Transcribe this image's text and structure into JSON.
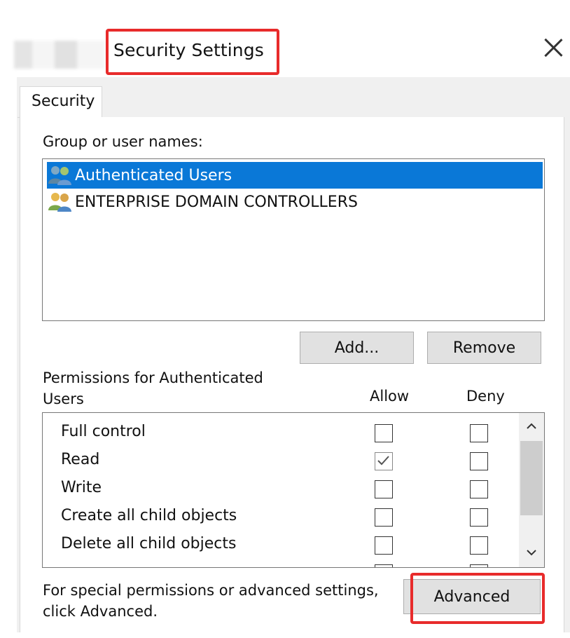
{
  "window": {
    "title": "Security Settings"
  },
  "tabs": [
    {
      "label": "Security"
    }
  ],
  "group_section": {
    "label": "Group or user names:",
    "users": [
      {
        "name": "Authenticated Users",
        "selected": true,
        "icon": "users-group-icon"
      },
      {
        "name": "ENTERPRISE DOMAIN CONTROLLERS",
        "selected": false,
        "icon": "users-group-icon"
      }
    ],
    "add_button": "Add...",
    "remove_button": "Remove"
  },
  "permissions": {
    "label_line1": "Permissions for Authenticated",
    "label_line2": "Users",
    "allow_header": "Allow",
    "deny_header": "Deny",
    "rows": [
      {
        "name": "Full control",
        "allow": false,
        "deny": false
      },
      {
        "name": "Read",
        "allow": true,
        "deny": false
      },
      {
        "name": "Write",
        "allow": false,
        "deny": false
      },
      {
        "name": "Create all child objects",
        "allow": false,
        "deny": false
      },
      {
        "name": "Delete all child objects",
        "allow": false,
        "deny": false
      }
    ]
  },
  "advanced": {
    "text_line1": "For special permissions or advanced settings,",
    "text_line2": "click Advanced.",
    "button": "Advanced"
  },
  "colors": {
    "selection": "#0a78d7",
    "highlight_box": "#e82b2b",
    "button_bg": "#e1e1e1"
  }
}
